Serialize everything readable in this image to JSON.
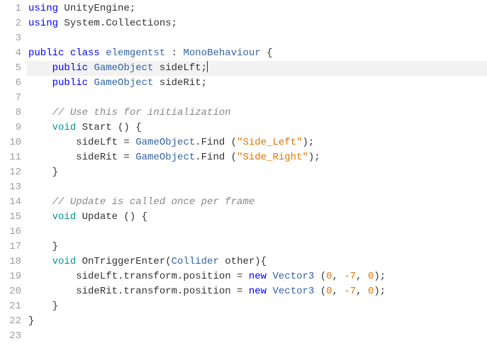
{
  "code": {
    "lines": [
      {
        "n": 1,
        "tokens": [
          {
            "cls": "kw-blue",
            "t": "using"
          },
          {
            "cls": "punct",
            "t": " UnityEngine"
          },
          {
            "cls": "punct",
            "t": ";"
          }
        ]
      },
      {
        "n": 2,
        "tokens": [
          {
            "cls": "kw-blue",
            "t": "using"
          },
          {
            "cls": "punct",
            "t": " System"
          },
          {
            "cls": "punct",
            "t": "."
          },
          {
            "cls": "punct",
            "t": "Collections"
          },
          {
            "cls": "punct",
            "t": ";"
          }
        ]
      },
      {
        "n": 3,
        "tokens": []
      },
      {
        "n": 4,
        "tokens": [
          {
            "cls": "kw-blue",
            "t": "public"
          },
          {
            "cls": "punct",
            "t": " "
          },
          {
            "cls": "kw-blue",
            "t": "class"
          },
          {
            "cls": "punct",
            "t": " "
          },
          {
            "cls": "type",
            "t": "elemgentst"
          },
          {
            "cls": "punct",
            "t": " : "
          },
          {
            "cls": "type",
            "t": "MonoBehaviour"
          },
          {
            "cls": "punct",
            "t": " {"
          }
        ]
      },
      {
        "n": 5,
        "hl": true,
        "cursor": true,
        "tokens": [
          {
            "cls": "punct",
            "t": "    "
          },
          {
            "cls": "kw-blue",
            "t": "public"
          },
          {
            "cls": "punct",
            "t": " "
          },
          {
            "cls": "type",
            "t": "GameObject"
          },
          {
            "cls": "punct",
            "t": " sideLft;"
          }
        ]
      },
      {
        "n": 6,
        "tokens": [
          {
            "cls": "punct",
            "t": "    "
          },
          {
            "cls": "kw-blue",
            "t": "public"
          },
          {
            "cls": "punct",
            "t": " "
          },
          {
            "cls": "type",
            "t": "GameObject"
          },
          {
            "cls": "punct",
            "t": " sideRit;"
          }
        ]
      },
      {
        "n": 7,
        "tokens": []
      },
      {
        "n": 8,
        "tokens": [
          {
            "cls": "punct",
            "t": "    "
          },
          {
            "cls": "comment",
            "t": "// Use this for initialization"
          }
        ]
      },
      {
        "n": 9,
        "tokens": [
          {
            "cls": "punct",
            "t": "    "
          },
          {
            "cls": "kw-teal",
            "t": "void"
          },
          {
            "cls": "punct",
            "t": " Start () {"
          }
        ]
      },
      {
        "n": 10,
        "tokens": [
          {
            "cls": "punct",
            "t": "        sideLft = "
          },
          {
            "cls": "type",
            "t": "GameObject"
          },
          {
            "cls": "punct",
            "t": ".Find ("
          },
          {
            "cls": "str",
            "t": "\"Side_Left\""
          },
          {
            "cls": "punct",
            "t": ");"
          }
        ]
      },
      {
        "n": 11,
        "tokens": [
          {
            "cls": "punct",
            "t": "        sideRit = "
          },
          {
            "cls": "type",
            "t": "GameObject"
          },
          {
            "cls": "punct",
            "t": ".Find ("
          },
          {
            "cls": "str",
            "t": "\"Side_Right\""
          },
          {
            "cls": "punct",
            "t": ");"
          }
        ]
      },
      {
        "n": 12,
        "tokens": [
          {
            "cls": "punct",
            "t": "    }"
          }
        ]
      },
      {
        "n": 13,
        "tokens": []
      },
      {
        "n": 14,
        "tokens": [
          {
            "cls": "punct",
            "t": "    "
          },
          {
            "cls": "comment",
            "t": "// Update is called once per frame"
          }
        ]
      },
      {
        "n": 15,
        "tokens": [
          {
            "cls": "punct",
            "t": "    "
          },
          {
            "cls": "kw-teal",
            "t": "void"
          },
          {
            "cls": "punct",
            "t": " Update () {"
          }
        ]
      },
      {
        "n": 16,
        "tokens": []
      },
      {
        "n": 17,
        "tokens": [
          {
            "cls": "punct",
            "t": "    }"
          }
        ]
      },
      {
        "n": 18,
        "tokens": [
          {
            "cls": "punct",
            "t": "    "
          },
          {
            "cls": "kw-teal",
            "t": "void"
          },
          {
            "cls": "punct",
            "t": " OnTriggerEnter("
          },
          {
            "cls": "type",
            "t": "Collider"
          },
          {
            "cls": "punct",
            "t": " other){"
          }
        ]
      },
      {
        "n": 19,
        "tokens": [
          {
            "cls": "punct",
            "t": "        sideLft.transform.position = "
          },
          {
            "cls": "kw-blue",
            "t": "new"
          },
          {
            "cls": "punct",
            "t": " "
          },
          {
            "cls": "type",
            "t": "Vector3"
          },
          {
            "cls": "punct",
            "t": " ("
          },
          {
            "cls": "num",
            "t": "0"
          },
          {
            "cls": "punct",
            "t": ", "
          },
          {
            "cls": "num",
            "t": "-7"
          },
          {
            "cls": "punct",
            "t": ", "
          },
          {
            "cls": "num",
            "t": "0"
          },
          {
            "cls": "punct",
            "t": ");"
          }
        ]
      },
      {
        "n": 20,
        "tokens": [
          {
            "cls": "punct",
            "t": "        sideRit.transform.position = "
          },
          {
            "cls": "kw-blue",
            "t": "new"
          },
          {
            "cls": "punct",
            "t": " "
          },
          {
            "cls": "type",
            "t": "Vector3"
          },
          {
            "cls": "punct",
            "t": " ("
          },
          {
            "cls": "num",
            "t": "0"
          },
          {
            "cls": "punct",
            "t": ", "
          },
          {
            "cls": "num",
            "t": "-7"
          },
          {
            "cls": "punct",
            "t": ", "
          },
          {
            "cls": "num",
            "t": "0"
          },
          {
            "cls": "punct",
            "t": ");"
          }
        ]
      },
      {
        "n": 21,
        "tokens": [
          {
            "cls": "punct",
            "t": "    }"
          }
        ]
      },
      {
        "n": 22,
        "tokens": [
          {
            "cls": "punct",
            "t": "}"
          }
        ]
      },
      {
        "n": 23,
        "tokens": []
      }
    ]
  }
}
